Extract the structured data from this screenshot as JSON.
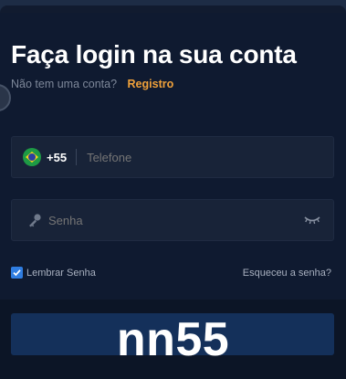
{
  "header": {
    "title": "Faça login na sua conta",
    "no_account_text": "Não tem uma conta?",
    "register_link": "Registro"
  },
  "phone": {
    "country_code": "+55",
    "placeholder": "Telefone"
  },
  "password": {
    "placeholder": "Senha"
  },
  "options": {
    "remember_label": "Lembrar Senha",
    "remember_checked": true,
    "forgot_link": "Esqueceu a senha?"
  },
  "watermark": {
    "text": "nn55"
  },
  "colors": {
    "background": "#0f1a30",
    "field": "#182338",
    "accent": "#f0a13a",
    "checkbox": "#2f7de1",
    "button": "#14305a"
  },
  "icons": [
    "brazil-flag-icon",
    "key-icon",
    "eye-closed-icon",
    "checkmark-icon"
  ]
}
